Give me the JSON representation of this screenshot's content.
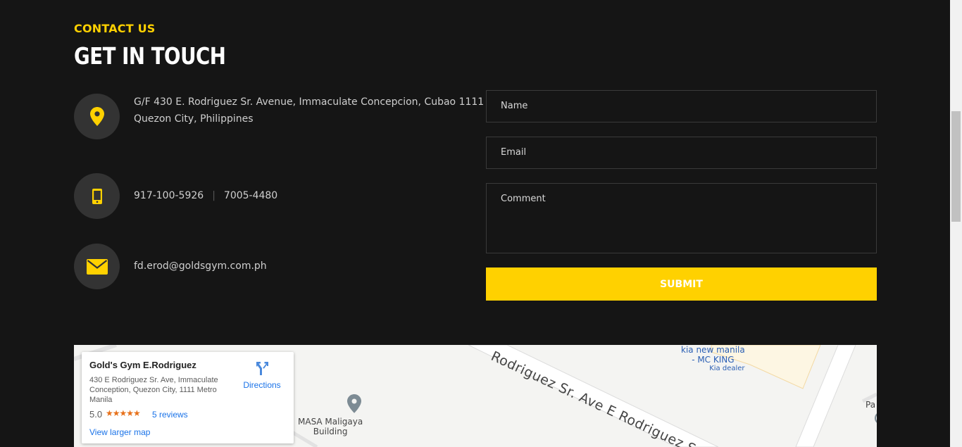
{
  "section": {
    "eyebrow": "CONTACT US",
    "title": "GET IN TOUCH"
  },
  "contact": {
    "address_line1": "G/F 430 E. Rodriguez Sr. Avenue, Immaculate Concepcion, Cubao 1111",
    "address_line2": "Quezon City, Philippines",
    "phone1": "917-100-5926",
    "phone_separator": "|",
    "phone2": "7005-4480",
    "email": "fd.erod@goldsgym.com.ph",
    "icons": [
      "map-pin-icon",
      "mobile-phone-icon",
      "envelope-icon"
    ]
  },
  "form": {
    "name_placeholder": "Name",
    "email_placeholder": "Email",
    "comment_placeholder": "Comment",
    "submit_label": "SUBMIT"
  },
  "map": {
    "place_name": "Gold's Gym E.Rodriguez",
    "place_address": "430 E Rodriguez Sr. Ave, Immaculate Conception, Quezon City, 1111 Metro Manila",
    "rating": "5.0",
    "stars": "★★★★★",
    "reviews_link": "5 reviews",
    "larger_map_link": "View larger map",
    "directions_label": "Directions",
    "street_label": "Rodriguez Sr. Ave E Rodriguez S",
    "poi_masa_line1": "MASA Maligaya",
    "poi_masa_line2": "Building",
    "poi_kia_line1": "kia new manila",
    "poi_kia_line2": "- MC KING",
    "poi_kia_sub": "Kia dealer",
    "poi_edge": "Pa"
  },
  "colors": {
    "accent": "#ffd100",
    "background": "#151515",
    "icon_circle": "#333333",
    "link_blue": "#1a73e8"
  }
}
